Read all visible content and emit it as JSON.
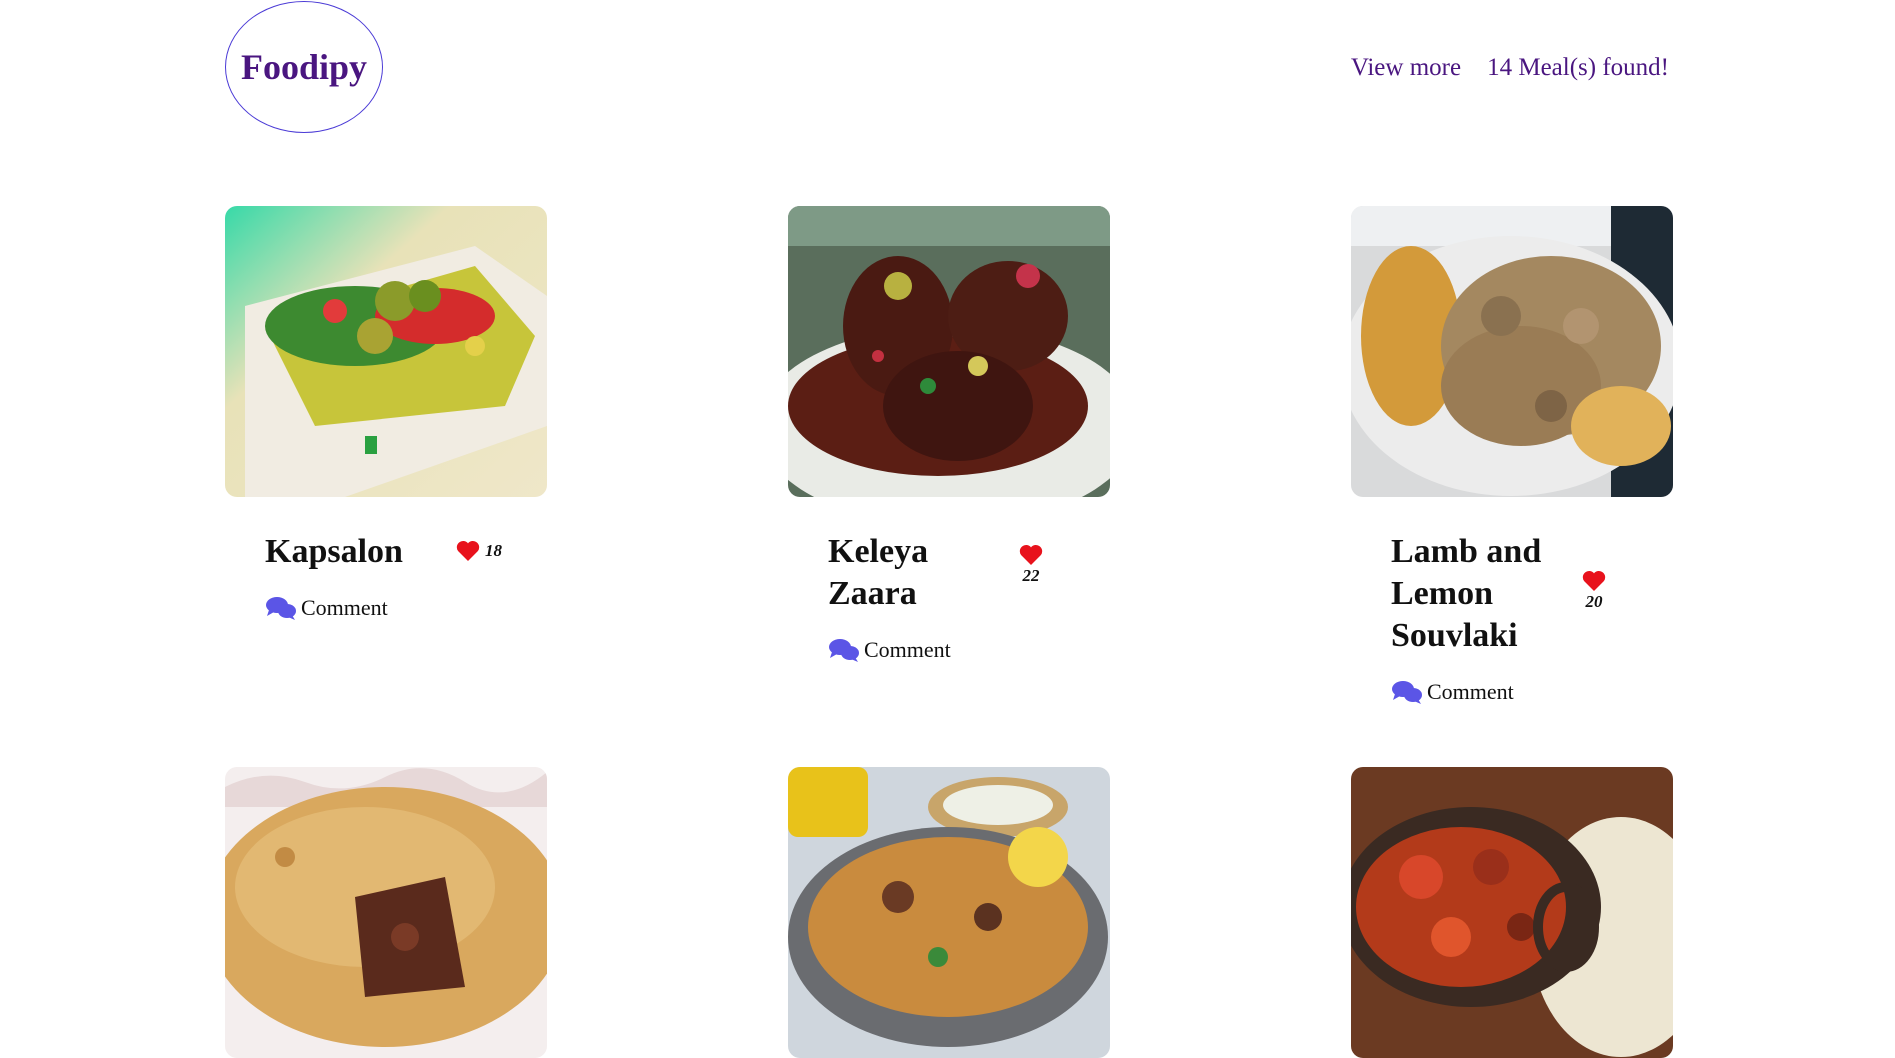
{
  "header": {
    "logo_text": "Foodipy",
    "view_more_label": "View more",
    "meals_found_text": "14 Meal(s) found!"
  },
  "colors": {
    "brand_purple": "#4a1680",
    "logo_border": "#4b3bd6",
    "heart_red": "#e8121c",
    "comment_icon": "#5b55e6"
  },
  "meals": [
    {
      "title": "Kapsalon",
      "likes": "18",
      "comment_label": "Comment",
      "image_icon": "kapsalon-photo"
    },
    {
      "title": "Keleya Zaara",
      "likes": "22",
      "comment_label": "Comment",
      "image_icon": "lamb-shanks-photo"
    },
    {
      "title": "Lamb and Lemon Souvlaki",
      "likes": "20",
      "comment_label": "Comment",
      "image_icon": "souvlaki-photo"
    },
    {
      "title": "",
      "likes": "",
      "comment_label": "",
      "image_icon": "meat-pie-photo"
    },
    {
      "title": "",
      "likes": "",
      "comment_label": "",
      "image_icon": "biryani-photo"
    },
    {
      "title": "",
      "likes": "",
      "comment_label": "",
      "image_icon": "stew-photo"
    }
  ]
}
